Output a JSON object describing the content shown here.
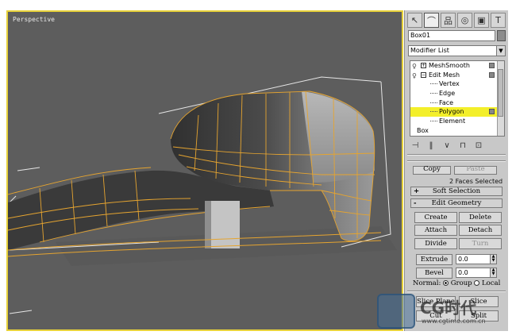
{
  "viewport": {
    "label": "Perspective"
  },
  "panel": {
    "tabs": [
      {
        "icon": "create-arrow-icon",
        "glyph": "↖"
      },
      {
        "icon": "modify-icon",
        "glyph": "⌒"
      },
      {
        "icon": "hierarchy-icon",
        "glyph": "品"
      },
      {
        "icon": "motion-icon",
        "glyph": "◎"
      },
      {
        "icon": "display-icon",
        "glyph": "▣"
      },
      {
        "icon": "utilities-hammer-icon",
        "glyph": "T"
      }
    ],
    "object_name": "Box01",
    "modifier_list": "Modifier List",
    "stack": {
      "meshsmooth": "MeshSmooth",
      "edit_mesh": "Edit Mesh",
      "vertex": "Vertex",
      "edge": "Edge",
      "face": "Face",
      "polygon": "Polygon",
      "element": "Element",
      "box": "Box"
    },
    "copy_label": "Copy",
    "paste_label": "Paste",
    "selection_info": "2 Faces Selected",
    "soft_selection": {
      "sign": "+",
      "title": "Soft Selection"
    },
    "edit_geometry": {
      "sign": "-",
      "title": "Edit Geometry"
    },
    "buttons": {
      "create": "Create",
      "delete": "Delete",
      "attach": "Attach",
      "detach": "Detach",
      "divide": "Divide",
      "turn": "Turn",
      "extrude": "Extrude",
      "bevel": "Bevel",
      "slice_plane": "Slice Plane",
      "slice": "Slice",
      "cut": "Cut",
      "split": "Split"
    },
    "extrude_value": "0.0",
    "bevel_value": "0.0",
    "normal_label": "Normal:",
    "group_label": "Group",
    "local_label": "Local"
  },
  "watermark": {
    "brand": "CG时代",
    "url": "www.cgtime.com.cn"
  }
}
